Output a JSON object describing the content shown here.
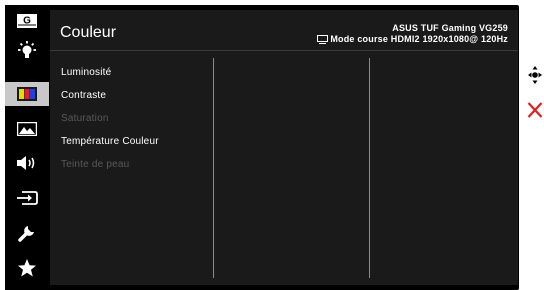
{
  "header": {
    "title": "Couleur",
    "model": "ASUS TUF Gaming  VG259",
    "mode_info": "Mode course HDMI2 1920x1080@ 120Hz"
  },
  "sidebar": {
    "items": [
      {
        "icon": "gaming-icon",
        "label": "G"
      },
      {
        "icon": "brightness-icon"
      },
      {
        "icon": "color-icon",
        "active": true
      },
      {
        "icon": "image-icon"
      },
      {
        "icon": "sound-icon"
      },
      {
        "icon": "input-icon"
      },
      {
        "icon": "system-setup-icon"
      },
      {
        "icon": "favorite-icon"
      }
    ]
  },
  "menu": {
    "items": [
      {
        "label": "Luminosité",
        "enabled": true
      },
      {
        "label": "Contraste",
        "enabled": true
      },
      {
        "label": "Saturation",
        "enabled": false
      },
      {
        "label": "Température Couleur",
        "enabled": true
      },
      {
        "label": "Teinte de peau",
        "enabled": false
      }
    ]
  },
  "controls": {
    "navigate_icon": "five-way-navigate-icon",
    "close_icon": "close-icon"
  },
  "colors": {
    "panel_bg": "#1a1a1a",
    "active_tab_bg": "#c8c8c8",
    "close_red": "#e02020"
  }
}
